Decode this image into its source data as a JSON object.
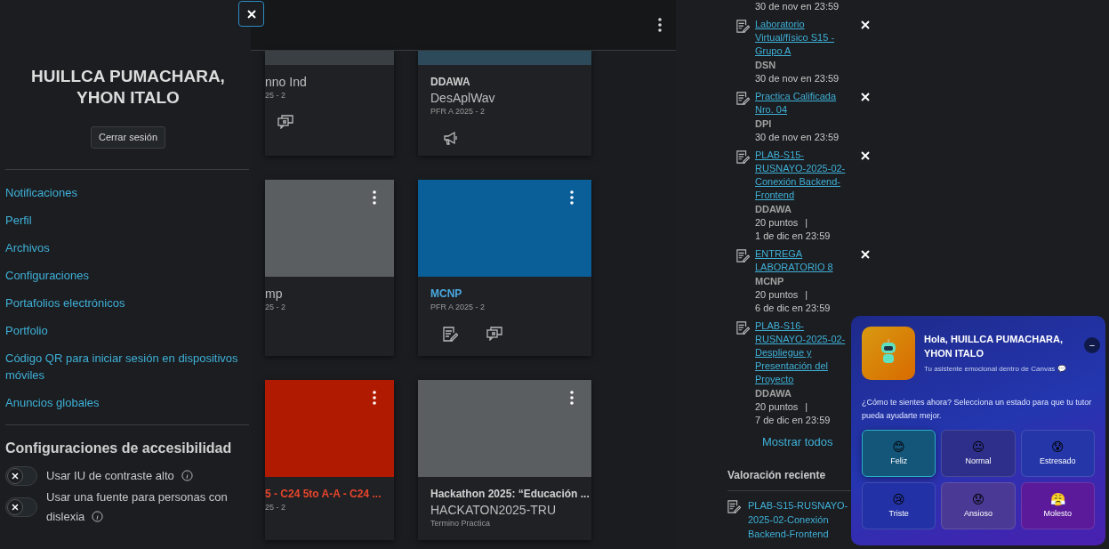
{
  "drawer": {
    "user_name": "HUILLCA PUMACHARA, YHON ITALO",
    "logout": "Cerrar sesión",
    "links": [
      "Notificaciones",
      "Perfil",
      "Archivos",
      "Configuraciones",
      "Portafolios electrónicos",
      "Portfolio",
      "Código QR para iniciar sesión en dispositivos móviles",
      "Anuncios globales"
    ],
    "accessibility": {
      "title": "Configuraciones de accesibilidad",
      "options": [
        {
          "label": "Usar IU de contraste alto",
          "on": false
        },
        {
          "label": "Usar una fuente para personas con dislexia",
          "on": false
        }
      ]
    }
  },
  "cards": [
    {
      "kind": "image",
      "name": "nno Ind",
      "term": "25 - 2",
      "icons": [
        {
          "kind": "discussion"
        }
      ],
      "color": "#3a3f44"
    },
    {
      "kind": "image",
      "code": "DDAWA",
      "name": "DesAplWav",
      "term": "PFR A 2025 - 2",
      "icons": [
        {
          "kind": "announcement"
        }
      ],
      "color": "#2c4a5a"
    },
    {
      "kind": "color",
      "name": "mp",
      "term": "25 - 2",
      "color": "#5a5e61"
    },
    {
      "kind": "color",
      "code": "MCNP",
      "term": "PFR A 2025 - 2",
      "icons": [
        {
          "kind": "assignment"
        },
        {
          "kind": "discussion"
        }
      ],
      "color": "#0a5f98"
    },
    {
      "kind": "color",
      "code": "5 - C24 5to A-A - C24 ...",
      "term": "25 - 2",
      "color": "#b01a00"
    },
    {
      "kind": "color",
      "code": "Hackathon 2025: “Educación ...",
      "name": "HACKATON2025-TRU",
      "term": "Termino Practica",
      "color": "#5a5e61"
    }
  ],
  "todo": {
    "items": [
      {
        "due": "30 de nov en 23:59",
        "dismissable": false
      },
      {
        "title": "Laboratorio Virtual/físico S15 - Grupo A",
        "course": "DSN",
        "due": "30 de nov en 23:59",
        "dismissable": true
      },
      {
        "title": "Practica Calificada Nro. 04",
        "course": "DPI",
        "due": "30 de nov en 23:59",
        "dismissable": true
      },
      {
        "title": "PLAB-S15-RUSNAYO-2025-02-Conexión Backend-Frontend",
        "course": "DDAWA",
        "points": "20 puntos",
        "separator": "|",
        "due": "1 de dic en 23:59",
        "dismissable": true
      },
      {
        "title": "ENTREGA LABORATORIO 8",
        "course": "MCNP",
        "points": "20 puntos",
        "separator": "|",
        "due": "6 de dic en 23:59",
        "dismissable": true
      },
      {
        "title": "PLAB-S16-RUSNAYO-2025-02-Despliegue y Presentación del Proyecto",
        "course": "DDAWA",
        "points": "20 puntos",
        "separator": "|",
        "due": "7 de dic en 23:59"
      }
    ],
    "show_all": "Mostrar todos",
    "recent_title": "Valoración reciente",
    "recent": [
      "PLAB-S15-RUSNAYO-2025-02-Conexión Backend-Frontend"
    ]
  },
  "widget": {
    "greeting": "Hola, HUILLCA PUMACHARA, YHON ITALO",
    "subtitle": "Tu asistente emocional dentro de Canvas 💬",
    "question": "¿Cómo te sientes ahora? Selecciona un estado para que tu tutor pueda ayudarte mejor.",
    "minimize": "−",
    "moods": [
      {
        "emoji": "😊",
        "label": "Feliz",
        "selected": true,
        "color": "#14557a"
      },
      {
        "emoji": "😐",
        "label": "Normal",
        "selected": false,
        "color": "#2d2f8a"
      },
      {
        "emoji": "😰",
        "label": "Estresado",
        "selected": false,
        "color": "#2536a8"
      },
      {
        "emoji": "😢",
        "label": "Triste",
        "selected": false,
        "color": "#2232a6"
      },
      {
        "emoji": "😟",
        "label": "Ansioso",
        "selected": false,
        "color": "#4a3a96"
      },
      {
        "emoji": "😤",
        "label": "Molesto",
        "selected": false,
        "color": "#5a1a9a"
      }
    ]
  }
}
